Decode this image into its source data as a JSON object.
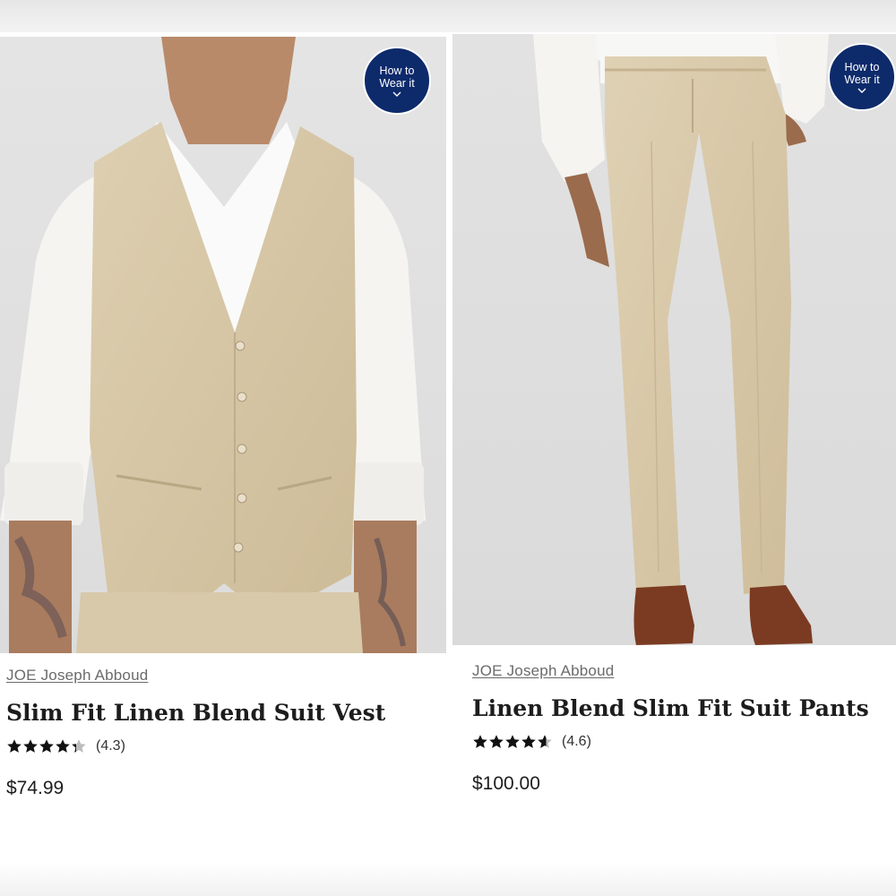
{
  "products": [
    {
      "brand": "JOE Joseph Abboud",
      "title": "Slim Fit Linen Blend Suit Vest",
      "rating": 4.3,
      "rating_text": "(4.3)",
      "price": "$74.99",
      "badge": {
        "line1": "How to",
        "line2": "Wear it",
        "icon": "chevron-down-icon"
      }
    },
    {
      "brand": "JOE Joseph Abboud",
      "title": "Linen Blend Slim Fit Suit Pants",
      "rating": 4.6,
      "rating_text": "(4.6)",
      "price": "$100.00",
      "badge": {
        "line1": "How to",
        "line2": "Wear it",
        "icon": "chevron-down-icon"
      }
    }
  ],
  "colors": {
    "badge_bg": "#0d2a6b",
    "linen": "#d9c9a9",
    "star": "#111111",
    "star_empty": "#bdbdbd"
  }
}
